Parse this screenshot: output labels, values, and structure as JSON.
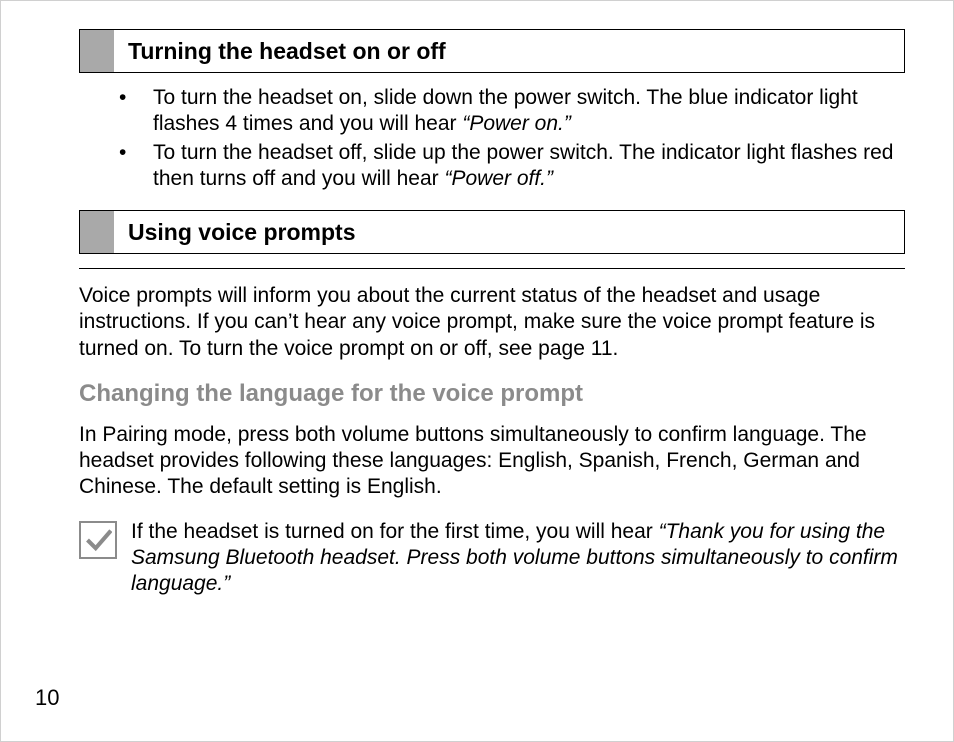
{
  "page_number": "10",
  "section1": {
    "title": "Turning the headset on or off",
    "bullets": [
      {
        "pre": "To turn the headset on, slide down the power switch. The blue indicator light flashes 4 times and you will hear ",
        "quote": "“Power on.”"
      },
      {
        "pre": "To turn the headset off, slide up the power switch. The indicator light flashes red then turns off and you will hear ",
        "quote": "“Power off.”"
      }
    ]
  },
  "section2": {
    "title": "Using voice prompts",
    "para": "Voice prompts will inform you about the current status of the headset and usage instructions. If you can’t hear any voice prompt, make sure the voice prompt feature is turned on. To turn the voice prompt on or off, see page 11."
  },
  "subsection": {
    "title": "Changing the language for the voice prompt",
    "para": "In Pairing mode, press both volume buttons simultaneously to confirm language. The headset provides following these languages: English, Spanish, French, German and Chinese. The default setting is English."
  },
  "note": {
    "icon": "checkmark-icon",
    "pre": "If the headset is turned on for the first time, you will hear ",
    "quote": "“Thank you for using the Samsung Bluetooth headset. Press both volume buttons simultaneously to confirm language.”"
  }
}
